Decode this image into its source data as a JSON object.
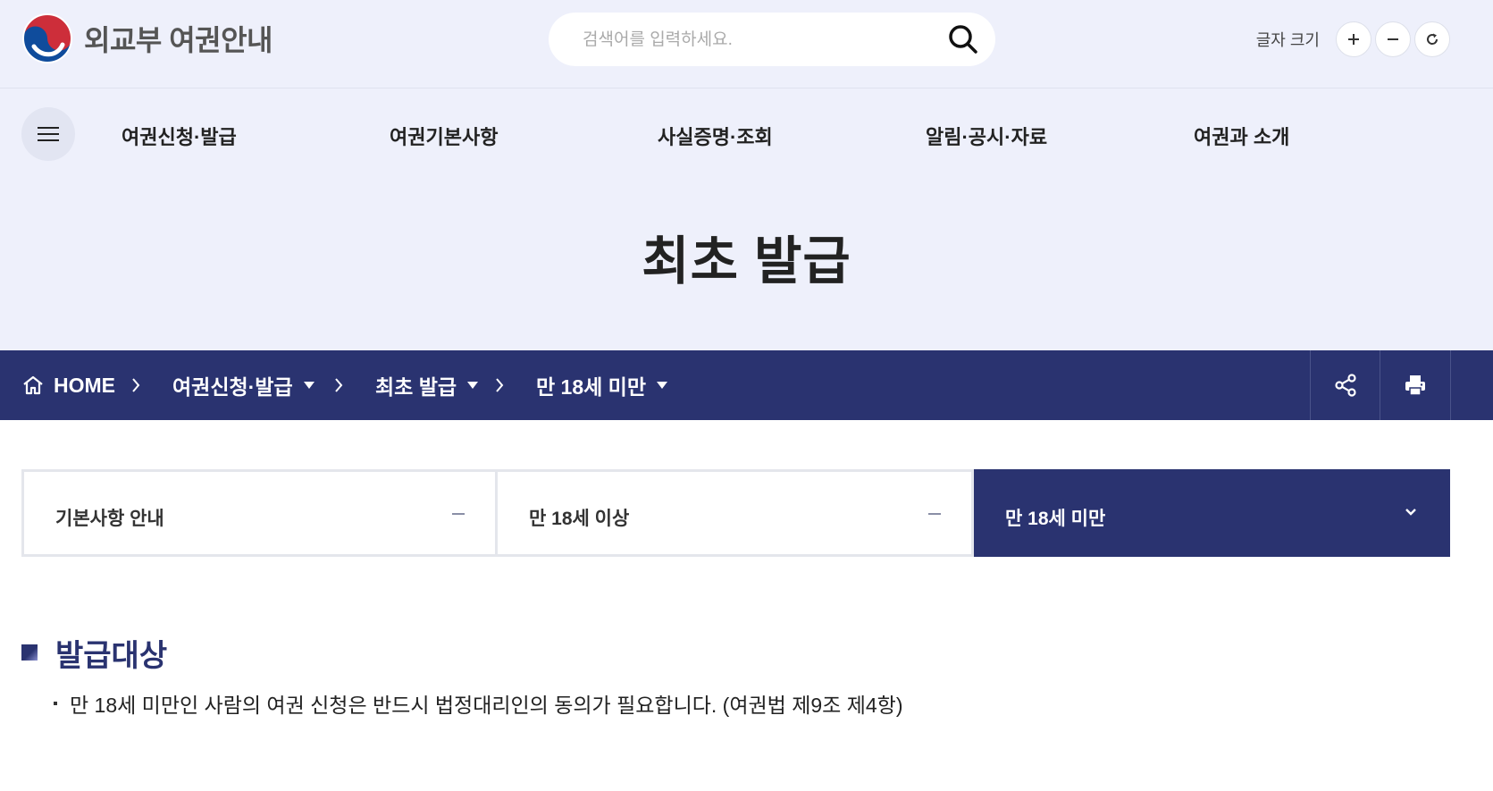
{
  "header": {
    "logo_text": "외교부 여권안내",
    "search_placeholder": "검색어를 입력하세요.",
    "font_size_label": "글자 크기"
  },
  "gnb": {
    "items": [
      {
        "label": "여권신청·발급"
      },
      {
        "label": "여권기본사항"
      },
      {
        "label": "사실증명·조회"
      },
      {
        "label": "알림·공시·자료"
      },
      {
        "label": "여권과 소개"
      }
    ]
  },
  "page": {
    "title": "최초 발급"
  },
  "breadcrumb": {
    "home": "HOME",
    "level1": "여권신청·발급",
    "level2": "최초 발급",
    "level3": "만 18세 미만"
  },
  "tabs": [
    {
      "label": "기본사항 안내",
      "active": false
    },
    {
      "label": "만 18세 이상",
      "active": false
    },
    {
      "label": "만 18세 미만",
      "active": true
    }
  ],
  "content": {
    "section_title": "발급대상",
    "description": "만 18세 미만인 사람의 여권 신청은 반드시 법정대리인의 동의가 필요합니다. (여권법 제9조 제4항)"
  },
  "colors": {
    "brand_navy": "#2a3370",
    "top_background": "#eef0fb",
    "emblem_red": "#cd2e3a",
    "emblem_blue": "#0f4c9c"
  },
  "icons": [
    "taegeuk-emblem-icon",
    "search-icon",
    "plus-icon",
    "minus-icon",
    "reset-icon",
    "hamburger-menu-icon",
    "home-icon",
    "chevron-right-icon",
    "caret-down-icon",
    "share-icon",
    "print-icon",
    "chevron-down-icon"
  ]
}
